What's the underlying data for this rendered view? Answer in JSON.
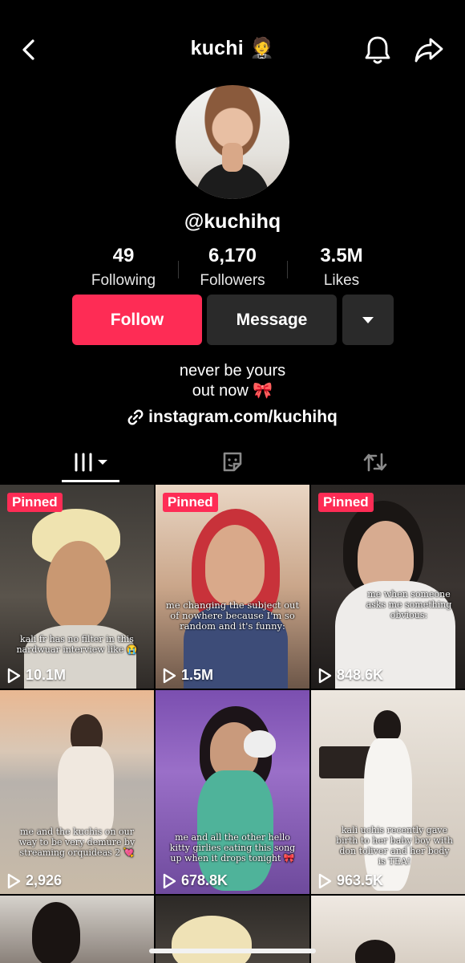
{
  "header": {
    "title": "kuchi 🤵"
  },
  "profile": {
    "handle": "@kuchihq",
    "stats": [
      {
        "value": "49",
        "label": "Following"
      },
      {
        "value": "6,170",
        "label": "Followers"
      },
      {
        "value": "3.5M",
        "label": "Likes"
      }
    ],
    "buttons": {
      "follow": "Follow",
      "message": "Message"
    },
    "bio_line1": "never be yours",
    "bio_line2": "out now 🎀",
    "link": "instagram.com/kuchihq"
  },
  "videos": [
    {
      "pinned": "Pinned",
      "views": "10.1M",
      "caption": "kali fr has no filter in this nardwuar interview like 😭"
    },
    {
      "pinned": "Pinned",
      "views": "1.5M",
      "caption": "me changing the subject out of nowhere because I'm so random and it's funny:"
    },
    {
      "pinned": "Pinned",
      "views": "848.6K",
      "caption": "me when someone asks me something obvious:"
    },
    {
      "pinned": "",
      "views": "2,926",
      "caption": "me and the kuchis on our way to be very demure by streaming orquideas 2 💘"
    },
    {
      "pinned": "",
      "views": "678.8K",
      "caption": "me and all the other hello kitty girlies eating this song up when it drops tonight 🎀"
    },
    {
      "pinned": "",
      "views": "963.5K",
      "caption": "kali uchis recently gave birth to her baby boy with don toliver and her body is TEA!"
    }
  ],
  "colors": {
    "accent": "#fe2c55",
    "button_dark": "#2a2a2a",
    "background": "#000000"
  }
}
